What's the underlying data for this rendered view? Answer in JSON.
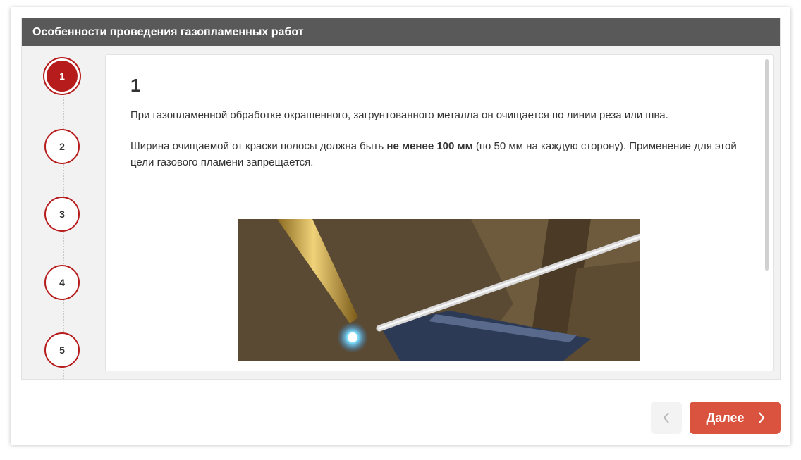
{
  "header": {
    "title": "Особенности проведения газопламенных работ"
  },
  "steps": [
    {
      "label": "1",
      "active": true
    },
    {
      "label": "2",
      "active": false
    },
    {
      "label": "3",
      "active": false
    },
    {
      "label": "4",
      "active": false
    },
    {
      "label": "5",
      "active": false
    }
  ],
  "content": {
    "heading": "1",
    "paragraph1": "При газопламенной обработке окрашенного, загрунтованного металла он очищается по линии реза или шва.",
    "paragraph2_before": "Ширина очищаемой от краски полосы должна быть ",
    "paragraph2_bold": "не менее 100 мм",
    "paragraph2_after": " (по 50 мм на каждую сторону). Применение для этой цели газового пламени запрещается."
  },
  "nav": {
    "next_label": "Далее"
  },
  "colors": {
    "header_bg": "#595959",
    "accent": "#b71c1c",
    "next_button": "#d9533e"
  },
  "icons": {
    "prev": "chevron-left-icon",
    "next": "chevron-right-icon"
  }
}
